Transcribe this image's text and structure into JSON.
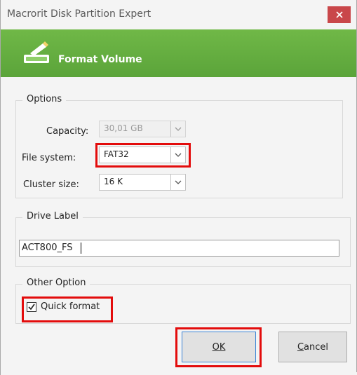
{
  "window": {
    "title": "Macrorit Disk Partition Expert",
    "close_label": "✕"
  },
  "banner": {
    "title": "Format Volume",
    "icon": "format-drive-icon"
  },
  "options": {
    "legend": "Options",
    "capacity_label": "Capacity:",
    "capacity_value": "30,01 GB",
    "filesystem_label": "File system:",
    "filesystem_value": "FAT32",
    "cluster_label": "Cluster size:",
    "cluster_value": "16 K"
  },
  "drive_label": {
    "legend": "Drive Label",
    "value": "ACT800_FS"
  },
  "other": {
    "legend": "Other Option",
    "quick_format_label": "Quick format",
    "quick_format_checked": true
  },
  "buttons": {
    "ok_label": "OK",
    "cancel_label": "Cancel"
  },
  "colors": {
    "accent": "#5ba43a",
    "close": "#c9474a",
    "highlight": "#e30c0c"
  }
}
